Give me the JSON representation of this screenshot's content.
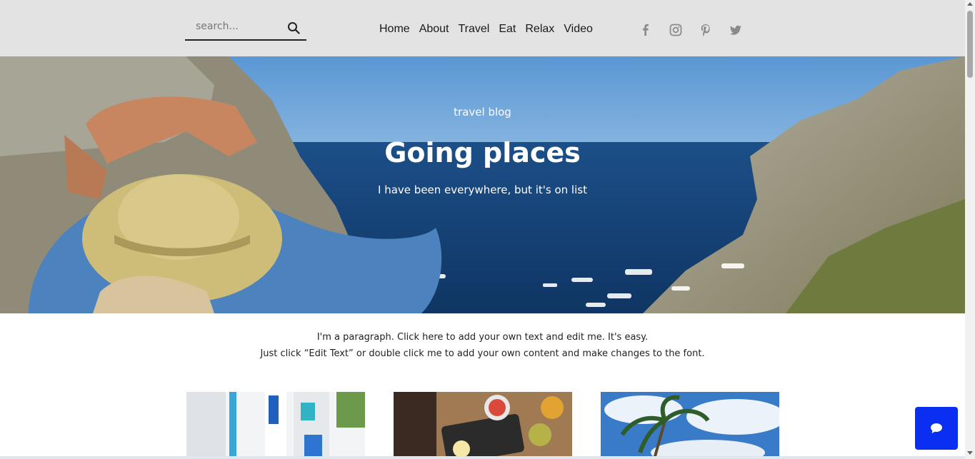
{
  "search": {
    "placeholder": "search..."
  },
  "nav": {
    "items": [
      "Home",
      "About",
      "Travel",
      "Eat",
      "Relax",
      "Video"
    ]
  },
  "social": [
    "facebook-icon",
    "instagram-icon",
    "pinterest-icon",
    "twitter-icon"
  ],
  "hero": {
    "kicker": "travel blog",
    "title": "Going places",
    "subtitle": "I have been everywhere, but it's on list"
  },
  "intro": {
    "line1": "I'm a paragraph. Click here to add your own text and edit me. It's easy.",
    "line2": "Just click “Edit Text” or double click me to add your own content and make changes to the font."
  },
  "colors": {
    "header_bg": "#e3e3e3",
    "chat_button": "#0a2ff0",
    "icon_gray": "#8a8a8a"
  }
}
